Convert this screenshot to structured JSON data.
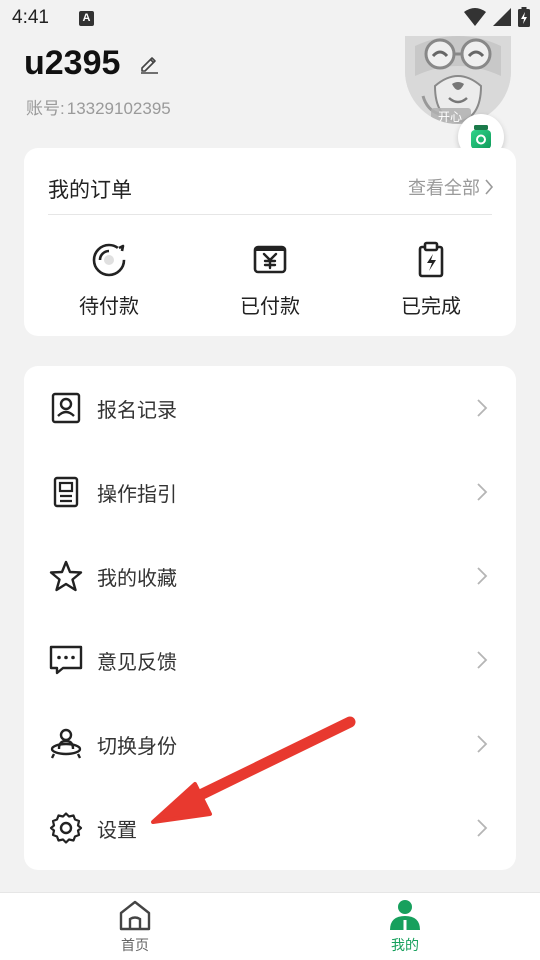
{
  "status_bar": {
    "time": "4:41",
    "notification_icon_letter": "A",
    "icons": [
      "wifi-icon",
      "signal-icon",
      "battery-icon"
    ]
  },
  "profile": {
    "username": "u2395",
    "account_label": "账号:",
    "account_value": "13329102395",
    "avatar_badge_text": "开心"
  },
  "orders": {
    "title": "我的订单",
    "view_all": "查看全部",
    "items": [
      {
        "label": "待付款",
        "icon": "pending-payment-icon"
      },
      {
        "label": "已付款",
        "icon": "yen-paid-icon"
      },
      {
        "label": "已完成",
        "icon": "completed-clipboard-icon"
      }
    ]
  },
  "menu": {
    "items": [
      {
        "label": "报名记录",
        "icon": "registration-record-icon"
      },
      {
        "label": "操作指引",
        "icon": "guide-document-icon"
      },
      {
        "label": "我的收藏",
        "icon": "star-icon"
      },
      {
        "label": "意见反馈",
        "icon": "feedback-chat-icon"
      },
      {
        "label": "切换身份",
        "icon": "switch-identity-icon"
      },
      {
        "label": "设置",
        "icon": "gear-icon"
      }
    ]
  },
  "bottom_nav": {
    "items": [
      {
        "label": "首页",
        "icon": "home-icon",
        "active": false
      },
      {
        "label": "我的",
        "icon": "person-icon",
        "active": true
      }
    ]
  },
  "colors": {
    "accent_green": "#17a05d",
    "annotation_arrow": "#e8392f",
    "background": "#f2f2f2"
  }
}
